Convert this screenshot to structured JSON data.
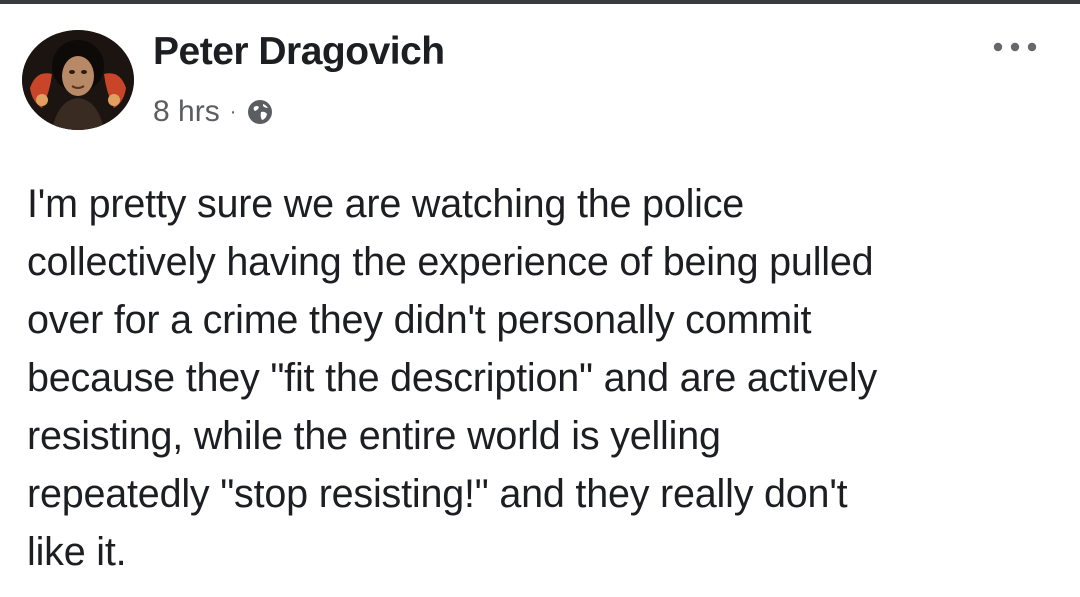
{
  "post": {
    "author": "Peter Dragovich",
    "time": "8 hrs",
    "separator": "·",
    "audience_icon": "globe-icon",
    "menu_icon": "more-options-icon",
    "text": "I'm pretty sure we are watching the police\ncollectively having the experience of being pulled\nover for a crime they didn't personally commit\nbecause they \"fit the description\" and are actively\nresisting, while the entire world is yelling\nrepeatedly \"stop resisting!\" and they really don't\nlike it."
  },
  "colors": {
    "name": "#1c1e21",
    "meta": "#5b5d61",
    "text": "#1c1e21",
    "avatar_bg": "#1b1410",
    "avatar_accent": "#c8452a"
  }
}
